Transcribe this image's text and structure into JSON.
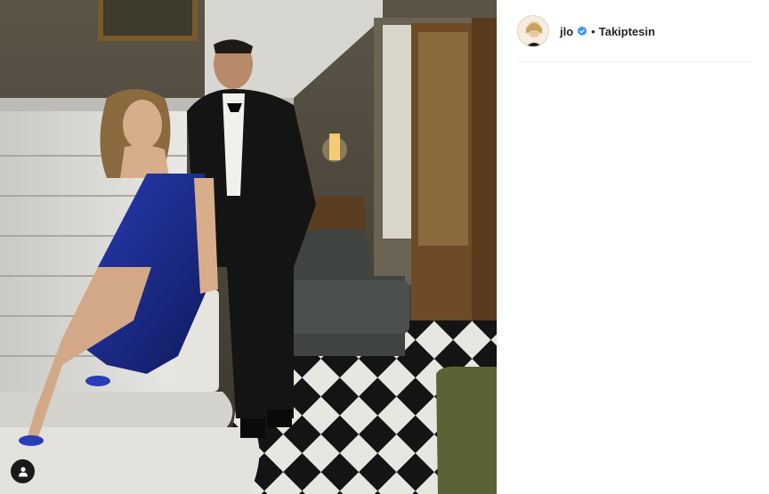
{
  "post": {
    "username": "jlo",
    "separator": "•",
    "follow_status": "Takiptesin"
  },
  "icons": {
    "verified": "verified-badge-icon",
    "tag_users": "user-icon"
  },
  "colors": {
    "verified": "#3897f0",
    "text": "#262626",
    "divider": "#efefef"
  }
}
